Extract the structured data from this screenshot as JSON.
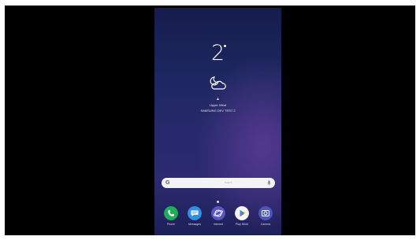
{
  "home_screen": {
    "clock": {
      "time": "2"
    },
    "weather": {
      "icon": "partly-cloudy-night-icon",
      "arrow": "▲",
      "location": "Upper West",
      "date_line": "SAMSUNG DEV TEST 2"
    },
    "search": {
      "icon": "google-g-icon",
      "g_glyph": "G",
      "placeholder": "Search",
      "mic_icon": "microphone-icon"
    },
    "dock": [
      {
        "label": "Phone",
        "icon": "phone-icon",
        "color": "#1eae5a"
      },
      {
        "label": "Messages",
        "icon": "messages-icon",
        "color": "#2f8fe0"
      },
      {
        "label": "Internet",
        "icon": "internet-icon",
        "color": "#5a55c8"
      },
      {
        "label": "Play Store",
        "icon": "play-store-icon",
        "color": "#f5f5f5"
      },
      {
        "label": "Camera",
        "icon": "camera-icon",
        "color": "#4b56c0"
      }
    ]
  },
  "colors": {
    "letterbox": "#000000",
    "wallpaper_top": "#161d4c",
    "wallpaper_bottom": "#2c2a70"
  }
}
